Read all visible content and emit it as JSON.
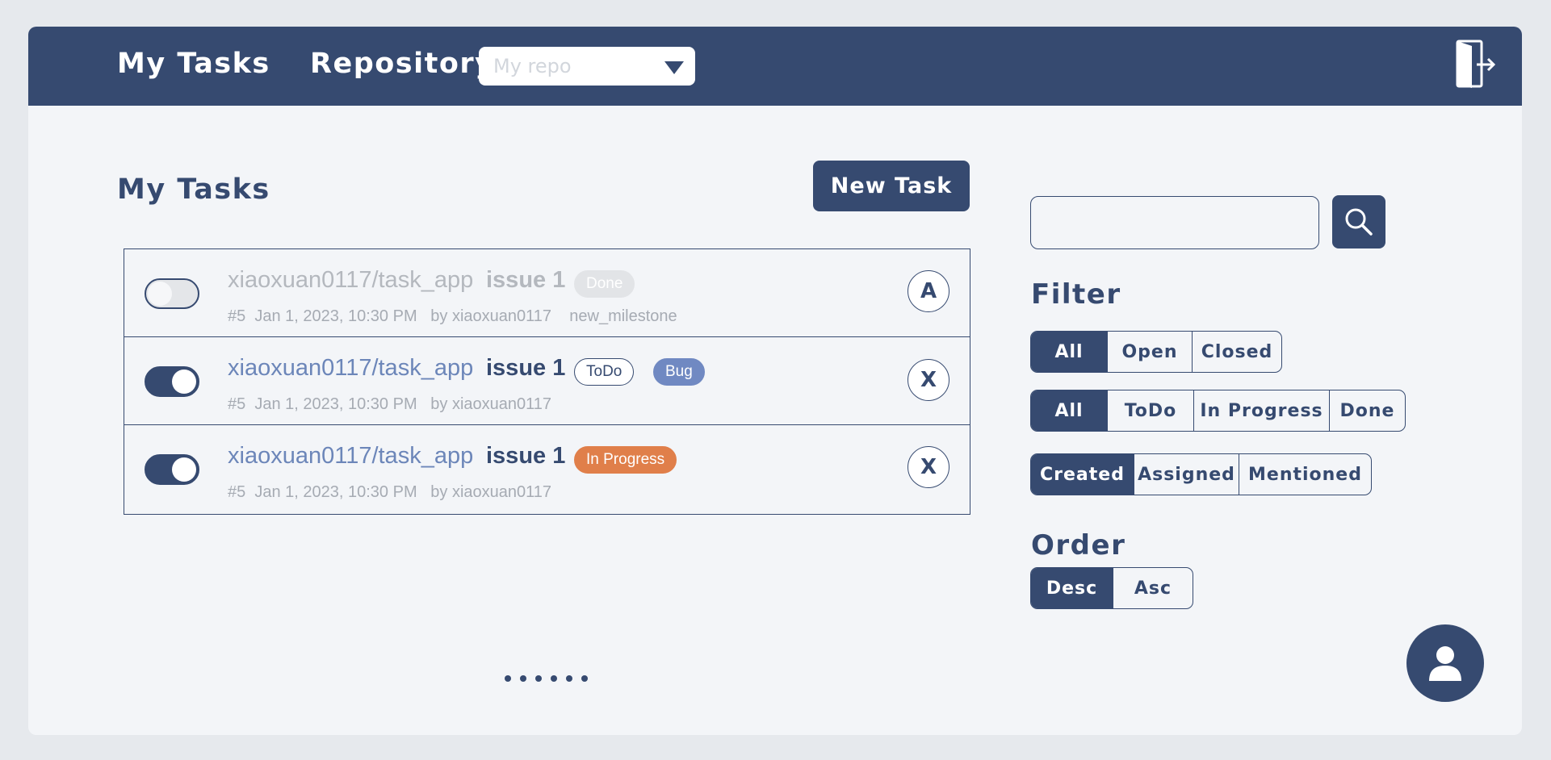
{
  "header": {
    "title": "My Tasks",
    "repo_label": "Repository",
    "repo_placeholder": "My repo",
    "logout_icon": "logout-door-icon"
  },
  "main": {
    "heading": "My Tasks",
    "new_task_label": "New Task",
    "tasks": [
      {
        "toggled": false,
        "repo": "xiaoxuan0117/task_app",
        "issue": "issue 1",
        "badges": [
          "Done"
        ],
        "meta": "#5  Jan 1, 2023, 10:30 PM   by xiaoxuan0117    new_milestone",
        "action": "A"
      },
      {
        "toggled": true,
        "repo": "xiaoxuan0117/task_app",
        "issue": "issue 1",
        "badges": [
          "ToDo",
          "Bug"
        ],
        "meta": "#5  Jan 1, 2023, 10:30 PM   by xiaoxuan0117",
        "action": "X"
      },
      {
        "toggled": true,
        "repo": "xiaoxuan0117/task_app",
        "issue": "issue 1",
        "badges": [
          "In Progress"
        ],
        "meta": "#5  Jan 1, 2023, 10:30 PM   by xiaoxuan0117",
        "action": "X"
      }
    ],
    "pager_dots": 6
  },
  "sidebar": {
    "search_placeholder": "",
    "filter_title": "Filter",
    "state_filter": [
      "All",
      "Open",
      "Closed"
    ],
    "status_filter": [
      "All",
      "ToDo",
      "In Progress",
      "Done"
    ],
    "relation_filter": [
      "Created",
      "Assigned",
      "Mentioned"
    ],
    "order_title": "Order",
    "order_options": [
      "Desc",
      "Asc"
    ]
  },
  "colors": {
    "primary": "#364a70",
    "link": "#6c86b9",
    "badge_bug": "#7089c2",
    "badge_in_progress": "#e07f4a",
    "background": "#f3f5f8"
  }
}
